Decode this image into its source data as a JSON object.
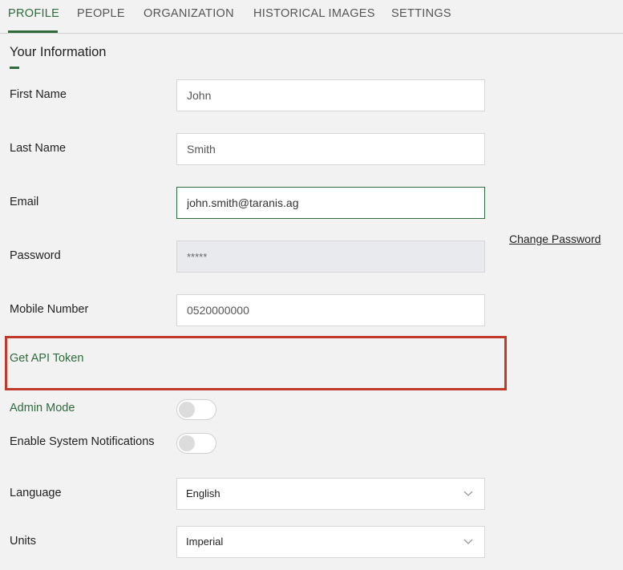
{
  "tabs": [
    {
      "label": "PROFILE"
    },
    {
      "label": "PEOPLE"
    },
    {
      "label": "ORGANIZATION"
    },
    {
      "label": "HISTORICAL IMAGES"
    },
    {
      "label": "SETTINGS"
    }
  ],
  "section_title": "Your Information",
  "fields": {
    "first_name": {
      "label": "First Name",
      "value": "John"
    },
    "last_name": {
      "label": "Last Name",
      "value": "Smith"
    },
    "email": {
      "label": "Email",
      "value": "john.smith@taranis.ag"
    },
    "password": {
      "label": "Password",
      "value": "*****"
    },
    "mobile": {
      "label": "Mobile Number",
      "value": "0520000000"
    }
  },
  "change_password_label": "Change Password",
  "api_token_label": "Get API Token",
  "toggles": {
    "admin_mode": {
      "label": "Admin Mode",
      "on": false
    },
    "system_notifications": {
      "label": "Enable System Notifications",
      "on": false
    }
  },
  "selects": {
    "language": {
      "label": "Language",
      "value": "English"
    },
    "units": {
      "label": "Units",
      "value": "Imperial"
    }
  },
  "colors": {
    "accent": "#2f6b3c",
    "highlight": "#c0392b"
  }
}
